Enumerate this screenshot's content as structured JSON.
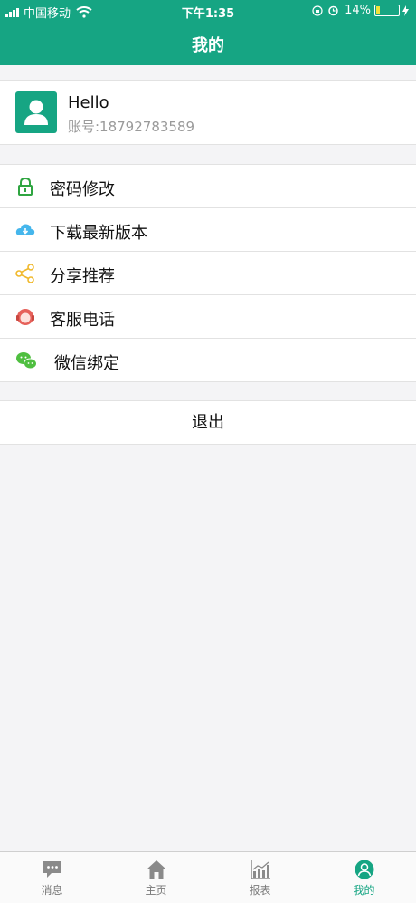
{
  "status_bar": {
    "carrier": "中国移动",
    "time": "下午1:35",
    "battery": "14%"
  },
  "header": {
    "title": "我的"
  },
  "profile": {
    "name": "Hello",
    "account": "账号:18792783589"
  },
  "menu": [
    {
      "label": "密码修改",
      "icon": "lock-icon"
    },
    {
      "label": "下载最新版本",
      "icon": "cloud-download-icon"
    },
    {
      "label": "分享推荐",
      "icon": "share-icon"
    },
    {
      "label": "客服电话",
      "icon": "customer-service-icon"
    },
    {
      "label": "微信绑定",
      "icon": "wechat-icon"
    }
  ],
  "logout_label": "退出",
  "tabs": [
    {
      "label": "消息",
      "icon": "message-icon"
    },
    {
      "label": "主页",
      "icon": "home-icon"
    },
    {
      "label": "报表",
      "icon": "chart-icon"
    },
    {
      "label": "我的",
      "icon": "user-icon",
      "active": true
    }
  ],
  "colors": {
    "brand": "#16a583",
    "background": "#f4f4f6"
  }
}
